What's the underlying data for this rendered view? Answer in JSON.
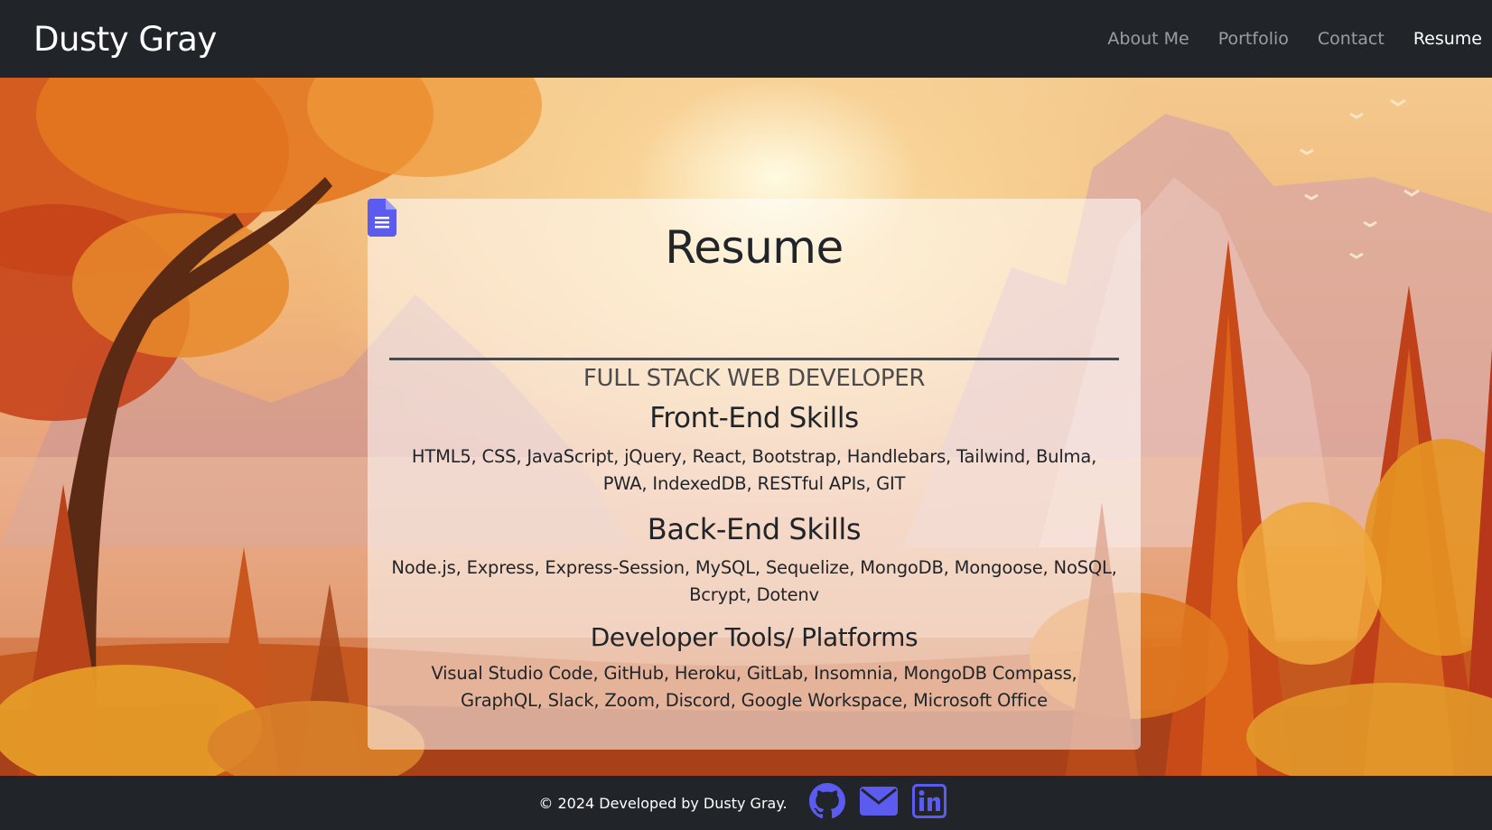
{
  "navbar": {
    "brand": "Dusty Gray",
    "links": [
      {
        "label": "About Me",
        "active": false
      },
      {
        "label": "Portfolio",
        "active": false
      },
      {
        "label": "Contact",
        "active": false
      },
      {
        "label": "Resume",
        "active": true
      }
    ]
  },
  "resume": {
    "title": "Resume",
    "icon": "file-document-icon",
    "subtitle": "FULL STACK WEB DEVELOPER",
    "sections": [
      {
        "title": "Front-End Skills",
        "text": "HTML5, CSS, JavaScript, jQuery, React, Bootstrap, Handlebars, Tailwind, Bulma, PWA, IndexedDB, RESTful APIs, GIT"
      },
      {
        "title": "Back-End Skills",
        "text": "Node.js, Express, Express-Session, MySQL, Sequelize, MongoDB, Mongoose, NoSQL, Bcrypt, Dotenv"
      },
      {
        "title": "Developer Tools/ Platforms",
        "text": "Visual Studio Code, GitHub, Heroku, GitLab, Insomnia, MongoDB Compass, GraphQL, Slack, Zoom, Discord, Google Workspace, Microsoft Office"
      }
    ]
  },
  "footer": {
    "text": "© 2024 Developed by Dusty Gray.",
    "icons": [
      "github-icon",
      "envelope-icon",
      "linkedin-icon"
    ]
  },
  "colors": {
    "navbar_bg": "#212529",
    "accent_icon": "#5b5bf0",
    "card_bg": "rgba(255,255,255,0.55)"
  }
}
